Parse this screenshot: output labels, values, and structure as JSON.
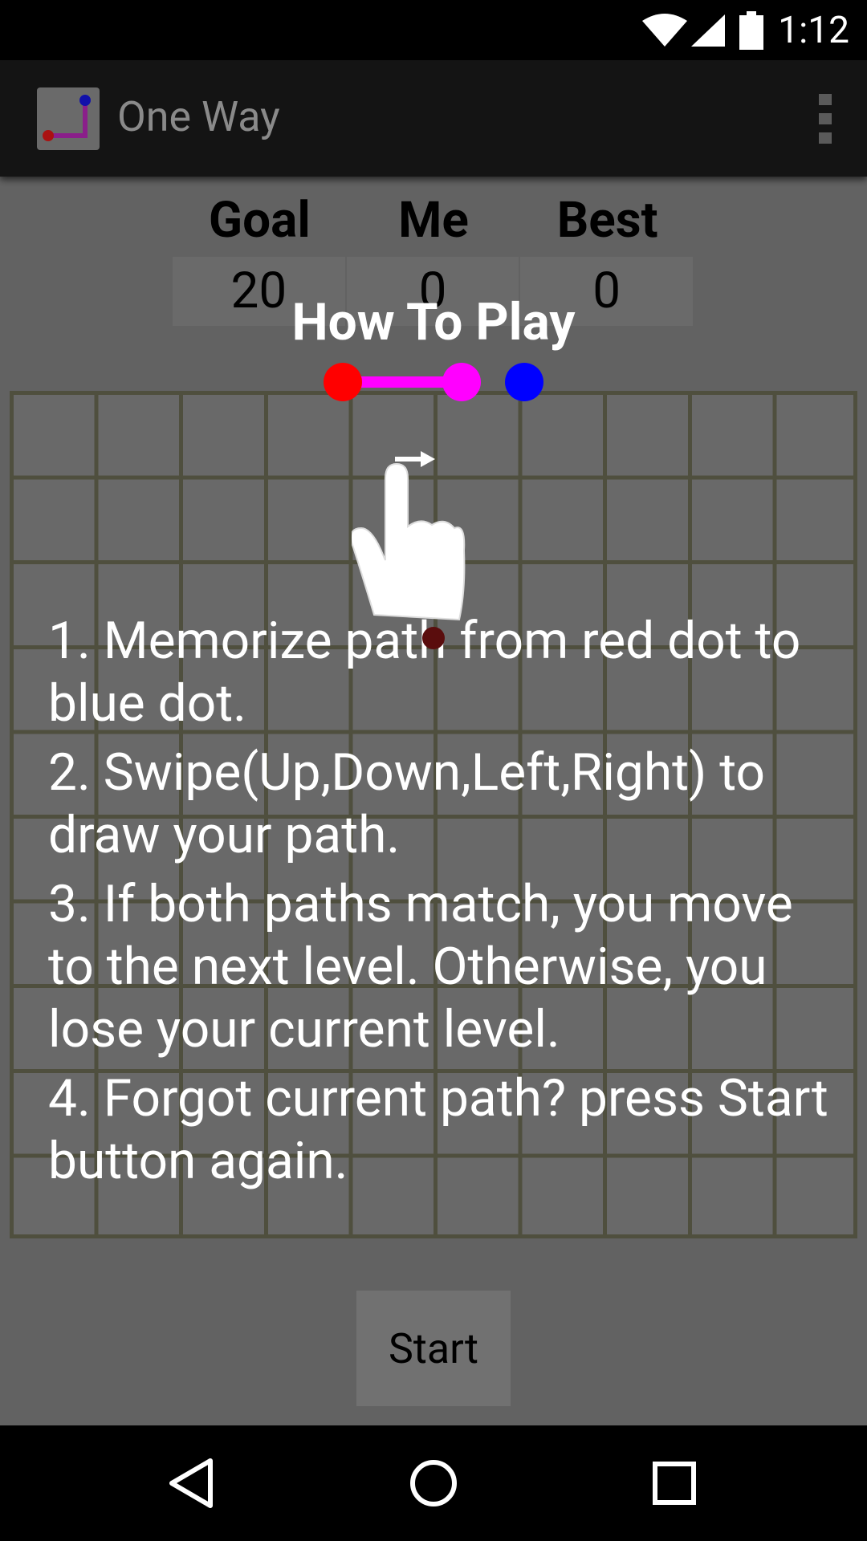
{
  "status_bar": {
    "time": "1:12",
    "icons": [
      "wifi-icon",
      "signal-icon",
      "battery-icon"
    ]
  },
  "app_bar": {
    "title": "One Way",
    "icon": "app-logo",
    "menu_icon": "overflow-menu-icon"
  },
  "scores": {
    "headers": [
      "Goal",
      "Me",
      "Best"
    ],
    "values": [
      "20",
      "0",
      "0"
    ]
  },
  "board": {
    "rows": 10,
    "cols": 10
  },
  "howto": {
    "title": "How To Play",
    "steps": [
      "1. Memorize path from red dot to blue dot.",
      "2. Swipe(Up,Down,Left,Right) to draw your path.",
      "3. If both paths match, you move to the next level. Otherwise, you lose your current level.",
      "4. Forgot current path? press Start button again."
    ],
    "demo_colors": {
      "start_dot": "#ff0000",
      "path": "#ff00ff",
      "end_dot": "#0000ff"
    }
  },
  "start_button": {
    "label": "Start"
  },
  "nav_bar": {
    "buttons": [
      "back-icon",
      "home-icon",
      "recents-icon"
    ]
  }
}
